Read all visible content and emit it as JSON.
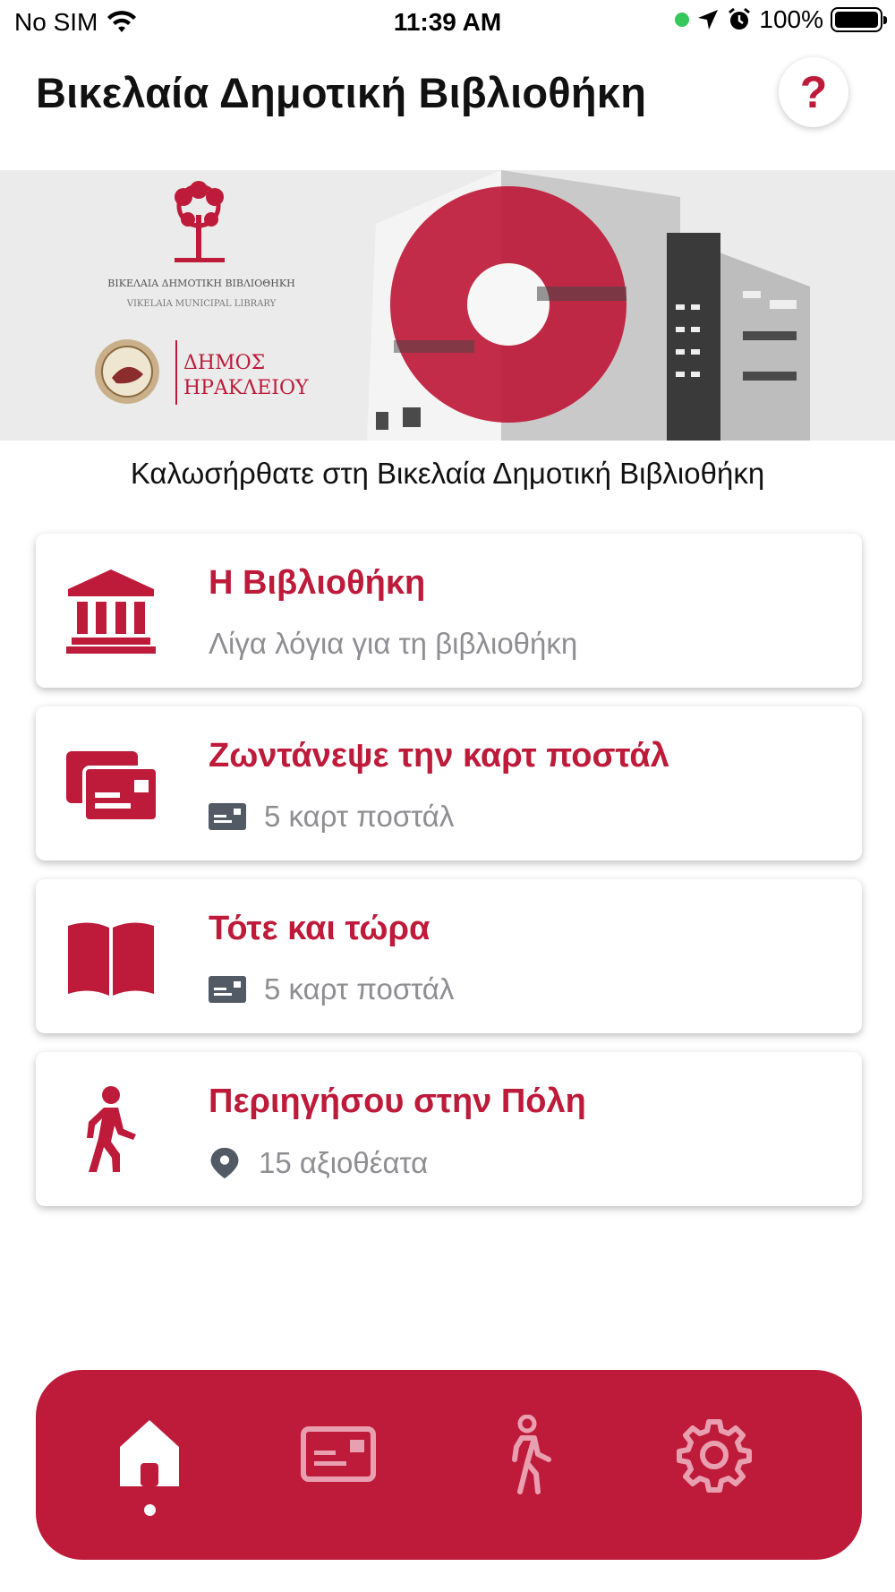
{
  "status_bar": {
    "carrier": "No SIM",
    "time": "11:39 AM",
    "battery": "100%"
  },
  "header": {
    "title": "Βικελαία Δημοτική Βιβλιοθήκη",
    "help_label": "?"
  },
  "banner": {
    "logo_line1": "ΒΙΚΕΛΑΙΑ ΔΗΜΟΤΙΚΗ ΒΙΒΛΙΟΘΗΚΗ",
    "logo_line2": "VIKELAIA MUNICIPAL LIBRARY",
    "municipality_line1": "ΔΗΜΟΣ",
    "municipality_line2": "ΗΡΑΚΛΕΙΟΥ"
  },
  "welcome_text": "Καλωσήρθατε στη Βικελαία Δημοτική Βιβλιοθήκη",
  "menu": [
    {
      "title": "Η Βιβλιοθήκη",
      "subtitle": "Λίγα λόγια για τη βιβλιοθήκη",
      "icon": "library-icon"
    },
    {
      "title": "Ζωντάνεψε την καρτ ποστάλ",
      "subtitle": "5 καρτ ποστάλ",
      "icon": "postcards-icon",
      "sub_icon": "postcard-icon"
    },
    {
      "title": "Τότε και τώρα",
      "subtitle": "5 καρτ ποστάλ",
      "icon": "open-book-icon",
      "sub_icon": "postcard-icon"
    },
    {
      "title": "Περιηγήσου στην Πόλη",
      "subtitle": "15 αξιοθέατα",
      "icon": "walking-person-icon",
      "sub_icon": "location-pin-icon"
    }
  ],
  "tab_bar": {
    "tabs": [
      "home-icon",
      "postcard-icon",
      "walking-person-icon",
      "gear-icon"
    ],
    "active": "home-icon"
  },
  "colors": {
    "accent": "#be1a3a",
    "subtitle": "#8e8e93",
    "tab_inactive": "#e8a0b0"
  }
}
